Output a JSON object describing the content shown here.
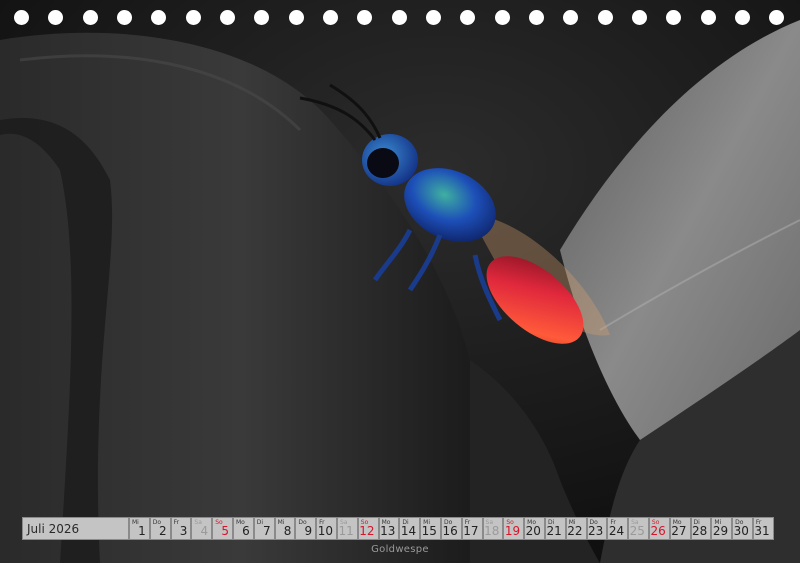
{
  "calendar": {
    "month_label": "Juli 2026",
    "days": [
      {
        "wd": "Mi",
        "num": "1",
        "type": "weekday"
      },
      {
        "wd": "Do",
        "num": "2",
        "type": "weekday"
      },
      {
        "wd": "Fr",
        "num": "3",
        "type": "weekday"
      },
      {
        "wd": "Sa",
        "num": "4",
        "type": "sat"
      },
      {
        "wd": "So",
        "num": "5",
        "type": "sun"
      },
      {
        "wd": "Mo",
        "num": "6",
        "type": "weekday"
      },
      {
        "wd": "Di",
        "num": "7",
        "type": "weekday"
      },
      {
        "wd": "Mi",
        "num": "8",
        "type": "weekday"
      },
      {
        "wd": "Do",
        "num": "9",
        "type": "weekday"
      },
      {
        "wd": "Fr",
        "num": "10",
        "type": "weekday"
      },
      {
        "wd": "Sa",
        "num": "11",
        "type": "sat"
      },
      {
        "wd": "So",
        "num": "12",
        "type": "sun"
      },
      {
        "wd": "Mo",
        "num": "13",
        "type": "weekday"
      },
      {
        "wd": "Di",
        "num": "14",
        "type": "weekday"
      },
      {
        "wd": "Mi",
        "num": "15",
        "type": "weekday"
      },
      {
        "wd": "Do",
        "num": "16",
        "type": "weekday"
      },
      {
        "wd": "Fr",
        "num": "17",
        "type": "weekday"
      },
      {
        "wd": "Sa",
        "num": "18",
        "type": "sat"
      },
      {
        "wd": "So",
        "num": "19",
        "type": "sun"
      },
      {
        "wd": "Mo",
        "num": "20",
        "type": "weekday"
      },
      {
        "wd": "Di",
        "num": "21",
        "type": "weekday"
      },
      {
        "wd": "Mi",
        "num": "22",
        "type": "weekday"
      },
      {
        "wd": "Do",
        "num": "23",
        "type": "weekday"
      },
      {
        "wd": "Fr",
        "num": "24",
        "type": "weekday"
      },
      {
        "wd": "Sa",
        "num": "25",
        "type": "sat"
      },
      {
        "wd": "So",
        "num": "26",
        "type": "sun"
      },
      {
        "wd": "Mo",
        "num": "27",
        "type": "weekday"
      },
      {
        "wd": "Di",
        "num": "28",
        "type": "weekday"
      },
      {
        "wd": "Mi",
        "num": "29",
        "type": "weekday"
      },
      {
        "wd": "Do",
        "num": "30",
        "type": "weekday"
      },
      {
        "wd": "Fr",
        "num": "31",
        "type": "weekday"
      }
    ]
  },
  "caption": "Goldwespe",
  "colors": {
    "sunday": "#d4152a",
    "saturday": "#9a9a9a",
    "cell_background": "#c4c4c4",
    "wasp_body": "#1a4fb0",
    "wasp_abdomen": "#d8283a"
  }
}
